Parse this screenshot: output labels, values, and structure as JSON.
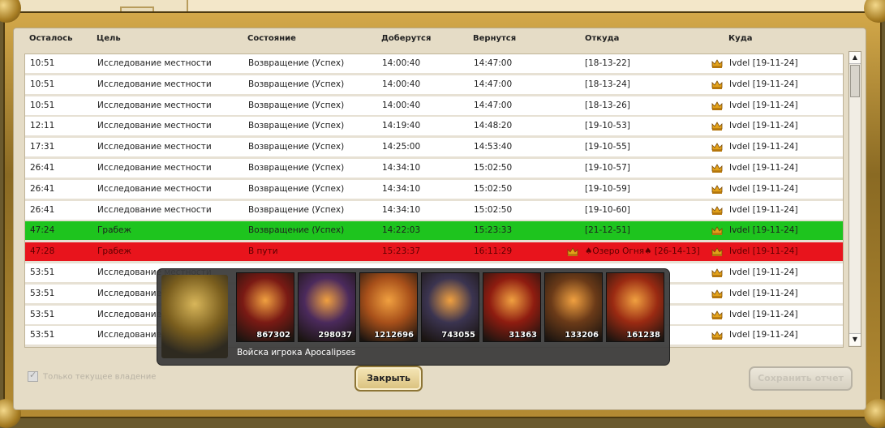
{
  "columns": {
    "remaining": "Осталось",
    "goal": "Цель",
    "status": "Состояние",
    "arrive": "Доберутся",
    "return": "Вернутся",
    "from": "Откуда",
    "to": "Куда"
  },
  "rows": [
    {
      "remaining": "10:51",
      "goal": "Исследование местности",
      "status": "Возвращение (Успех)",
      "arrive": "14:00:40",
      "return": "14:47:00",
      "from": "[18-13-22]",
      "to": "Ivdel [19-11-24]"
    },
    {
      "remaining": "10:51",
      "goal": "Исследование местности",
      "status": "Возвращение (Успех)",
      "arrive": "14:00:40",
      "return": "14:47:00",
      "from": "[18-13-24]",
      "to": "Ivdel [19-11-24]"
    },
    {
      "remaining": "10:51",
      "goal": "Исследование местности",
      "status": "Возвращение (Успех)",
      "arrive": "14:00:40",
      "return": "14:47:00",
      "from": "[18-13-26]",
      "to": "Ivdel [19-11-24]"
    },
    {
      "remaining": "12:11",
      "goal": "Исследование местности",
      "status": "Возвращение (Успех)",
      "arrive": "14:19:40",
      "return": "14:48:20",
      "from": "[19-10-53]",
      "to": "Ivdel [19-11-24]"
    },
    {
      "remaining": "17:31",
      "goal": "Исследование местности",
      "status": "Возвращение (Успех)",
      "arrive": "14:25:00",
      "return": "14:53:40",
      "from": "[19-10-55]",
      "to": "Ivdel [19-11-24]"
    },
    {
      "remaining": "26:41",
      "goal": "Исследование местности",
      "status": "Возвращение (Успех)",
      "arrive": "14:34:10",
      "return": "15:02:50",
      "from": "[19-10-57]",
      "to": "Ivdel [19-11-24]"
    },
    {
      "remaining": "26:41",
      "goal": "Исследование местности",
      "status": "Возвращение (Успех)",
      "arrive": "14:34:10",
      "return": "15:02:50",
      "from": "[19-10-59]",
      "to": "Ivdel [19-11-24]"
    },
    {
      "remaining": "26:41",
      "goal": "Исследование местности",
      "status": "Возвращение (Успех)",
      "arrive": "14:34:10",
      "return": "15:02:50",
      "from": "[19-10-60]",
      "to": "Ivdel [19-11-24]"
    },
    {
      "remaining": "47:24",
      "goal": "Грабеж",
      "status": "Возвращение (Успех)",
      "arrive": "14:22:03",
      "return": "15:23:33",
      "from": "[21-12-51]",
      "to": "Ivdel [19-11-24]",
      "highlight": "green"
    },
    {
      "remaining": "47:28",
      "goal": "Грабеж",
      "status": "В пути",
      "arrive": "15:23:37",
      "return": "16:11:29",
      "from": "♠Озеро Огня♠ [26-14-13]",
      "from_crown": true,
      "to": "Ivdel [19-11-24]",
      "highlight": "red"
    },
    {
      "remaining": "53:51",
      "goal": "Исследование местности",
      "status": "",
      "arrive": "",
      "return": "",
      "from": "",
      "to": "Ivdel [19-11-24]"
    },
    {
      "remaining": "53:51",
      "goal": "Исследование местности",
      "status": "",
      "arrive": "",
      "return": "",
      "from": "",
      "to": "Ivdel [19-11-24]"
    },
    {
      "remaining": "53:51",
      "goal": "Исследование местности",
      "status": "",
      "arrive": "",
      "return": "",
      "from": "",
      "to": "Ivdel [19-11-24]"
    },
    {
      "remaining": "53:51",
      "goal": "Исследование местности",
      "status": "",
      "arrive": "",
      "return": "",
      "from": "",
      "to": "Ivdel [19-11-24]"
    }
  ],
  "popup": {
    "caption": "Войска игрока Apocalipses",
    "units": [
      {
        "count": "867302",
        "icon": "red-dragon-icon",
        "color": "#7a1a14"
      },
      {
        "count": "298037",
        "icon": "lich-icon",
        "color": "#4b2a5c"
      },
      {
        "count": "1212696",
        "icon": "fire-beast-icon",
        "color": "#a8501a"
      },
      {
        "count": "743055",
        "icon": "bone-dragon-icon",
        "color": "#3b3450"
      },
      {
        "count": "31363",
        "icon": "fire-elemental-icon",
        "color": "#8e1c10"
      },
      {
        "count": "133206",
        "icon": "warlord-icon",
        "color": "#6a3a18"
      },
      {
        "count": "161238",
        "icon": "fire-mage-icon",
        "color": "#9a2a12"
      }
    ]
  },
  "footer": {
    "checkbox_label": "Только текущее владение",
    "close_label": "Закрыть",
    "save_label": "Сохранить отчет"
  },
  "colors": {
    "row_green": "#1ec41e",
    "row_red": "#e8141c",
    "frame_gold": "#b48b33"
  }
}
